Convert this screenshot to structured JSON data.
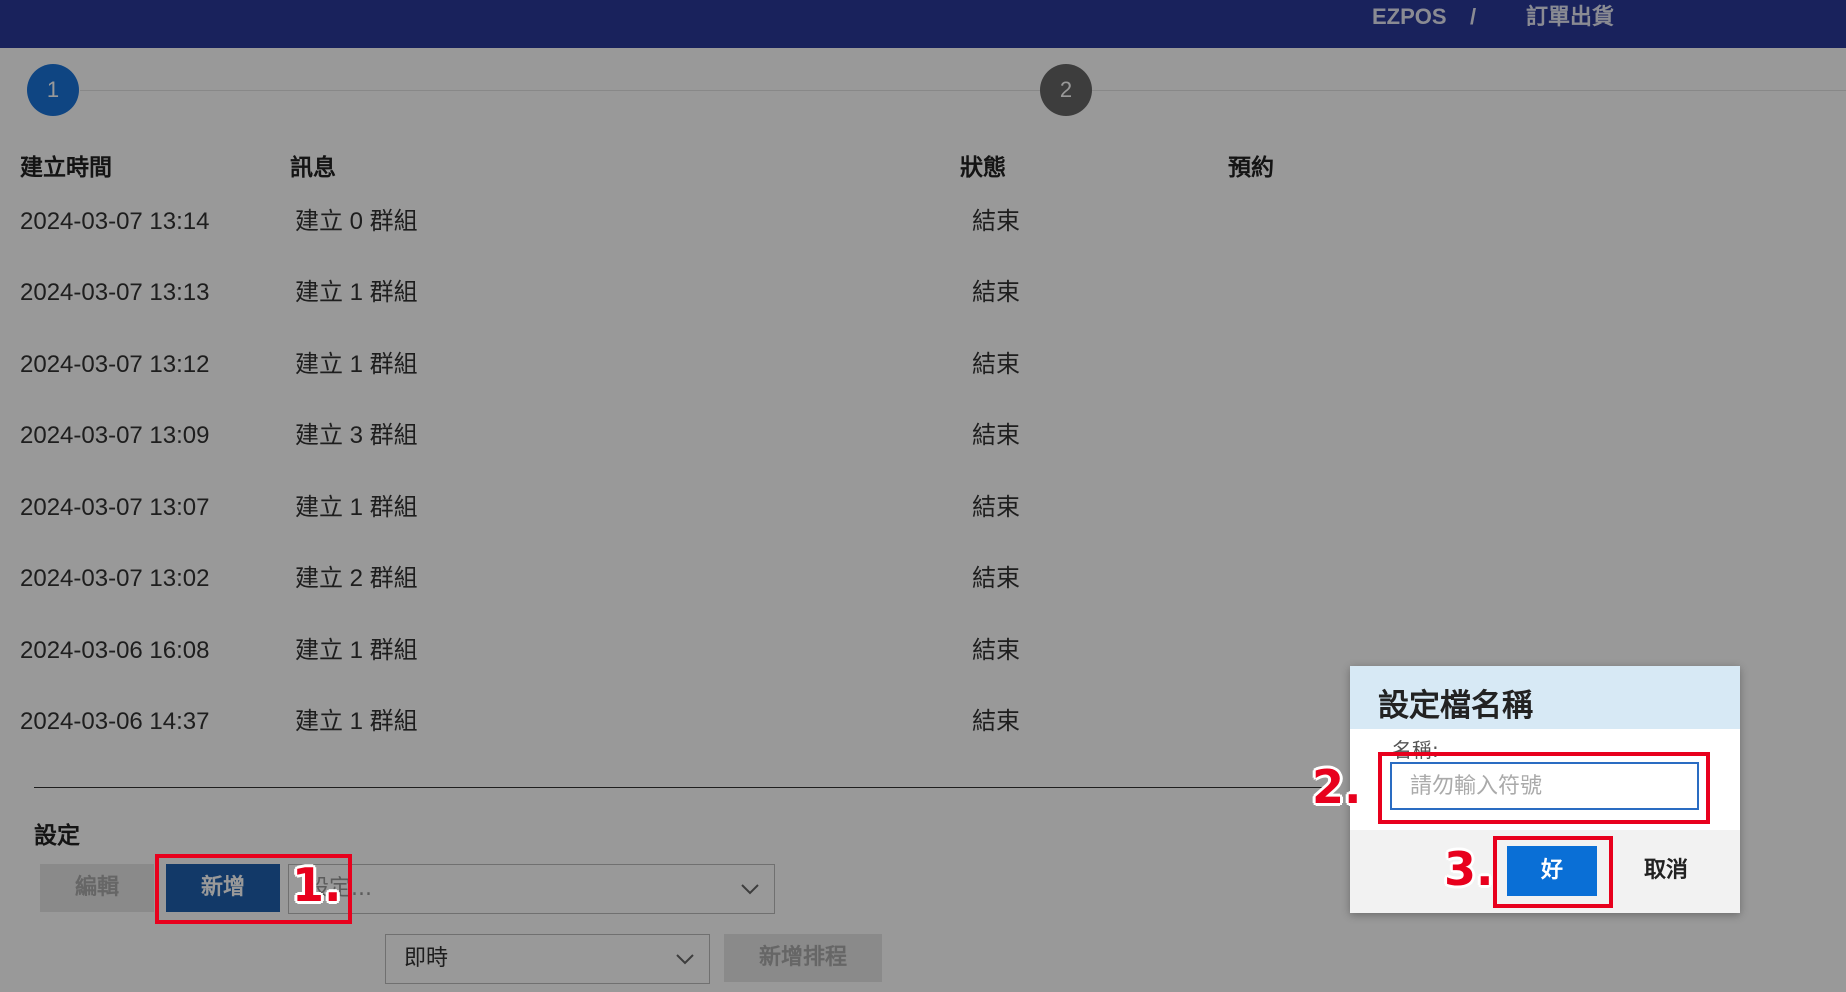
{
  "breadcrumb": {
    "app": "EZPOS",
    "separator": "/",
    "page": "訂單出貨"
  },
  "steps": [
    {
      "label": "1"
    },
    {
      "label": "2"
    }
  ],
  "table": {
    "headers": [
      "建立時間",
      "訊息",
      "狀態",
      "預約"
    ],
    "rows": [
      {
        "time": "2024-03-07 13:14",
        "message": "建立 0 群組",
        "status": "結束"
      },
      {
        "time": "2024-03-07 13:13",
        "message": "建立 1 群組",
        "status": "結束"
      },
      {
        "time": "2024-03-07 13:12",
        "message": "建立 1 群組",
        "status": "結束"
      },
      {
        "time": "2024-03-07 13:09",
        "message": "建立 3 群組",
        "status": "結束"
      },
      {
        "time": "2024-03-07 13:07",
        "message": "建立 1 群組",
        "status": "結束"
      },
      {
        "time": "2024-03-07 13:02",
        "message": "建立 2 群組",
        "status": "結束"
      },
      {
        "time": "2024-03-06 16:08",
        "message": "建立 1 群組",
        "status": "結束"
      },
      {
        "time": "2024-03-06 14:37",
        "message": "建立 1 群組",
        "status": "結束"
      }
    ]
  },
  "settings": {
    "label": "設定",
    "edit_label": "編輯",
    "add_label": "新增",
    "profile_placeholder": "設定...",
    "mode_value": "即時",
    "add_schedule_label": "新增排程"
  },
  "dialog": {
    "title": "設定檔名稱",
    "name_label": "名稱:",
    "name_placeholder": "請勿輸入符號",
    "ok_label": "好",
    "cancel_label": "取消"
  },
  "annotations": {
    "step1": "1.",
    "step2": "2.",
    "step3": "3."
  },
  "colors": {
    "topbar": "#2b3a9a",
    "primary": "#1f5fad",
    "ok": "#0a6fd6",
    "annotation": "#e8001d"
  }
}
